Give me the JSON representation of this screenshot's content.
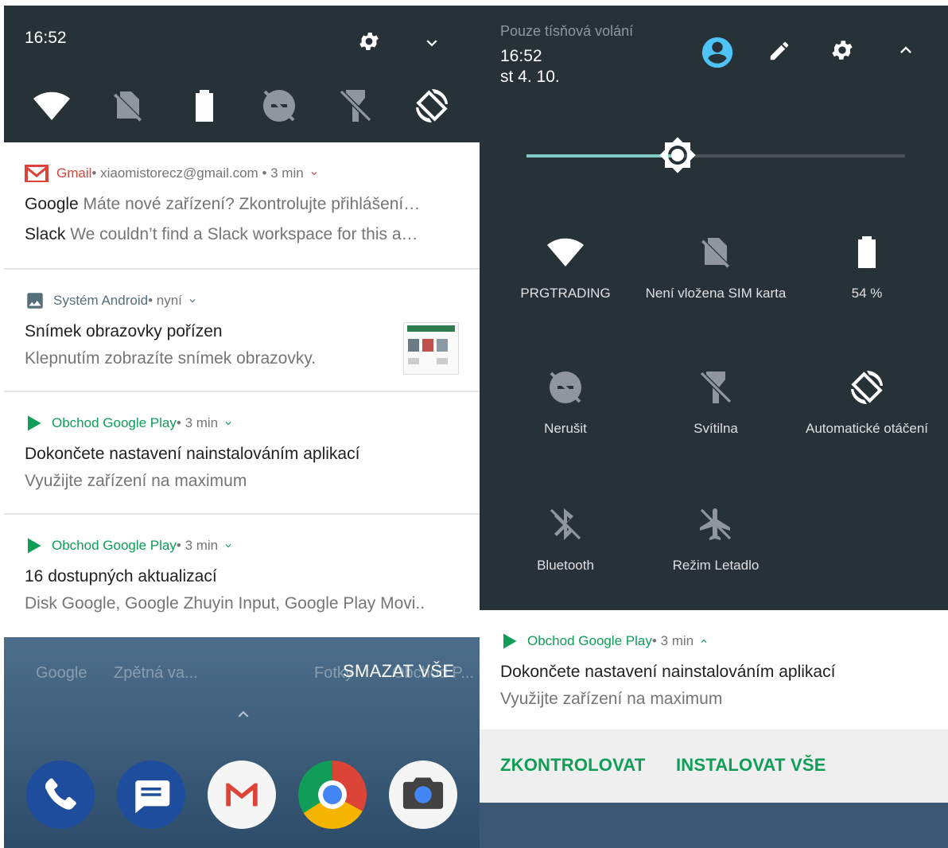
{
  "left": {
    "status": {
      "time": "16:52"
    },
    "qs_tiles": [
      "wifi-icon",
      "no-sim-icon",
      "battery-icon",
      "dnd-icon",
      "flashlight-icon",
      "auto-rotate-icon"
    ],
    "notifications": [
      {
        "app": "Gmail",
        "meta": " • xiaomistorecz@gmail.com • 3 min",
        "lines": [
          {
            "title": "Google",
            "text": " Máte nové zařízení? Zkontrolujte přihlášení…"
          },
          {
            "title": "Slack",
            "text": " We couldn’t find a Slack workspace for this a…"
          }
        ]
      },
      {
        "app": "Systém Android",
        "meta": " • nyní",
        "title": "Snímek obrazovky pořízen",
        "text": "Klepnutím zobrazíte snímek obrazovky."
      },
      {
        "app": "Obchod Google Play",
        "meta": " • 3 min",
        "title": "Dokončete nastavení nainstalováním aplikací",
        "text": "Využijte zařízení na maximum"
      },
      {
        "app": "Obchod Google Play",
        "meta": " • 3 min",
        "title": "16 dostupných aktualizací",
        "text": "Disk Google, Google Zhuyin Input, Google Play Movi.."
      }
    ],
    "home": {
      "labels": [
        "Google",
        "Zpětná va...",
        "Fotky",
        "Obchod P..."
      ],
      "clear_all": "SMAZAT VŠE"
    },
    "colors": {
      "qs_bg": "#263238",
      "gmail": "#db4437",
      "play": "#0f9d58"
    }
  },
  "right": {
    "emergency": "Pouze tísňová volání",
    "time": "16:52",
    "date": "st 4. 10.",
    "brightness": 0.4,
    "tiles": [
      {
        "icon": "wifi-icon",
        "label": "PRGTRADING",
        "on": true
      },
      {
        "icon": "no-sim-icon",
        "label": "Není vložena SIM karta",
        "on": false
      },
      {
        "icon": "battery-icon",
        "label": "54 %",
        "on": true
      },
      {
        "icon": "dnd-icon",
        "label": "Nerušit",
        "on": false
      },
      {
        "icon": "flashlight-icon",
        "label": "Svítilna",
        "on": false
      },
      {
        "icon": "auto-rotate-icon",
        "label": "Automatické otáčení",
        "on": true
      },
      {
        "icon": "bluetooth-icon",
        "label": "Bluetooth",
        "on": false
      },
      {
        "icon": "airplane-icon",
        "label": "Režim Letadlo",
        "on": false
      }
    ],
    "notification": {
      "app": "Obchod Google Play",
      "meta": " • 3 min",
      "title": "Dokončete nastavení nainstalováním aplikací",
      "text": "Využijte zařízení na maximum",
      "actions": [
        "ZKONTROLOVAT",
        "INSTALOVAT VŠE"
      ]
    },
    "colors": {
      "accent": "#4fc3f7",
      "brightness_track": "#80cbc4"
    }
  }
}
